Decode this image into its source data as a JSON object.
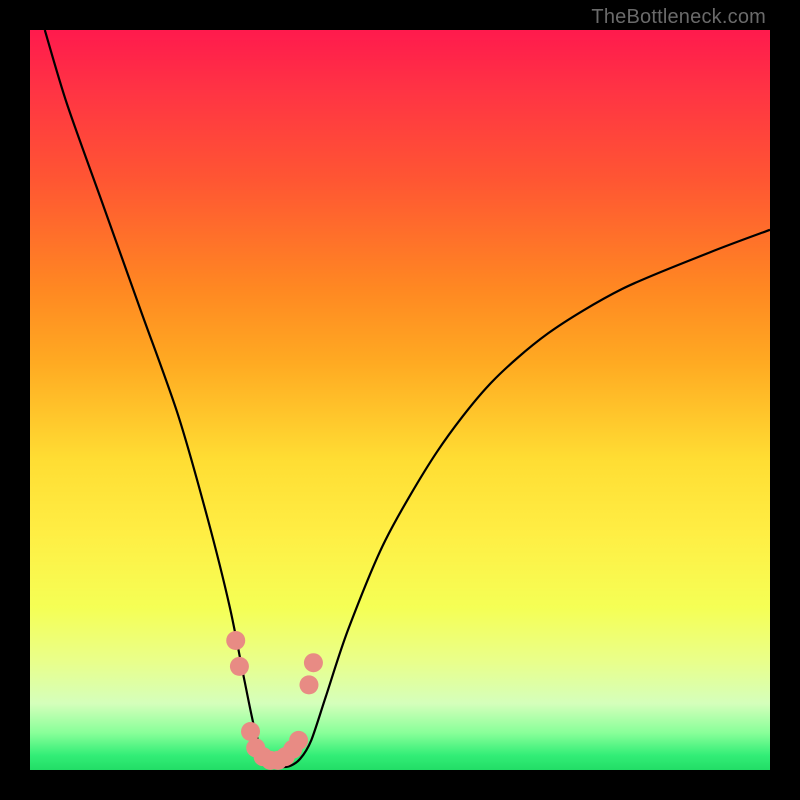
{
  "watermark": "TheBottleneck.com",
  "chart_data": {
    "type": "line",
    "title": "",
    "xlabel": "",
    "ylabel": "",
    "xlim": [
      0,
      100
    ],
    "ylim": [
      0,
      100
    ],
    "series": [
      {
        "name": "bottleneck-curve",
        "x": [
          2,
          5,
          10,
          15,
          20,
          24,
          27,
          29,
          30.5,
          32,
          33.5,
          35,
          36.5,
          38,
          40,
          43,
          48,
          55,
          62,
          70,
          80,
          92,
          100
        ],
        "values": [
          100,
          90,
          76,
          62,
          48,
          34,
          22,
          12,
          5,
          1.5,
          0.5,
          0.5,
          1.5,
          4,
          10,
          19,
          31,
          43,
          52,
          59,
          65,
          70,
          73
        ]
      }
    ],
    "markers": {
      "name": "highlight-dots",
      "color": "#e88b84",
      "points": [
        {
          "x": 27.8,
          "y": 17.5
        },
        {
          "x": 28.3,
          "y": 14.0
        },
        {
          "x": 29.8,
          "y": 5.2
        },
        {
          "x": 30.5,
          "y": 3.0
        },
        {
          "x": 31.5,
          "y": 1.8
        },
        {
          "x": 32.5,
          "y": 1.3
        },
        {
          "x": 33.5,
          "y": 1.3
        },
        {
          "x": 34.5,
          "y": 1.8
        },
        {
          "x": 35.5,
          "y": 2.8
        },
        {
          "x": 36.3,
          "y": 4.0
        },
        {
          "x": 37.7,
          "y": 11.5
        },
        {
          "x": 38.3,
          "y": 14.5
        }
      ]
    },
    "colors": {
      "curve": "#000000",
      "marker": "#e88b84",
      "background_top": "#ff1a4d",
      "background_bottom": "#22dd66"
    }
  }
}
